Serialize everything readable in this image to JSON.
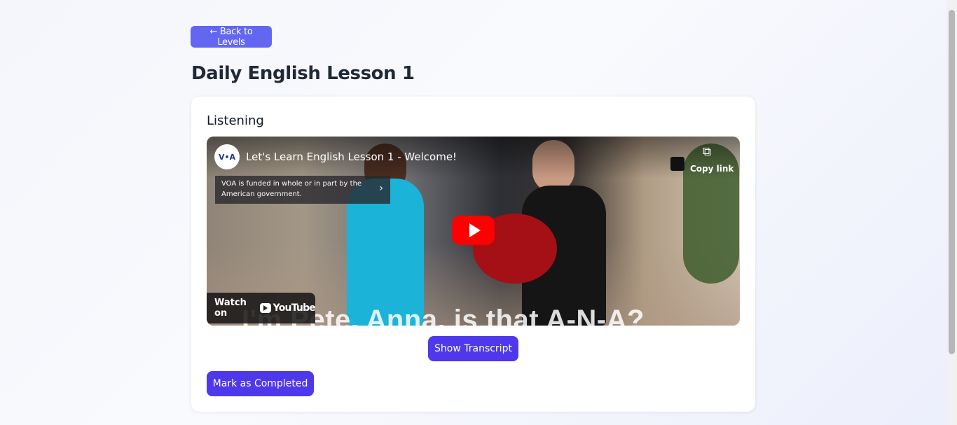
{
  "nav": {
    "back_label": "← Back to Levels"
  },
  "page": {
    "title": "Daily English Lesson 1"
  },
  "lesson": {
    "section_title": "Listening",
    "video": {
      "channel_logo_text": "V•A",
      "title": "Let's Learn English Lesson 1 - Welcome!",
      "notice": "VOA is funded in whole or in part by the American government.",
      "copy_link_label": "Copy link",
      "watch_on_label": "Watch on",
      "youtube_wordmark": "YouTube",
      "caption": "I'm Pete. Anna, is that A-N-A?"
    },
    "transcript_label": "Show Transcript",
    "complete_label": "Mark as Completed"
  },
  "colors": {
    "accent": "#4f38ec",
    "back_button": "#6366f1",
    "play_button": "#ff0000"
  },
  "icons": [
    "copy-icon",
    "play-icon",
    "youtube-icon",
    "chevron-right-icon"
  ]
}
